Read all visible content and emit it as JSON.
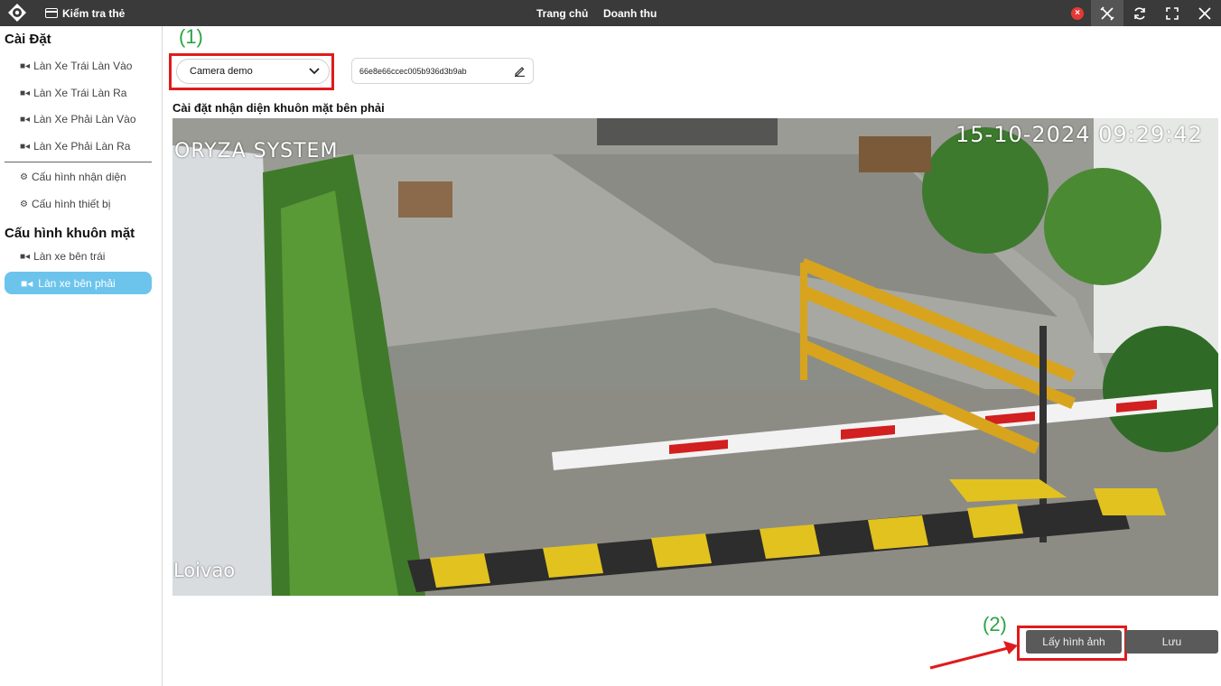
{
  "topbar": {
    "check_card_label": "Kiểm tra thẻ",
    "nav_home": "Trang chủ",
    "nav_revenue": "Doanh thu",
    "close_badge": "×"
  },
  "sidebar": {
    "section_settings": "Cài Đặt",
    "lane_items": [
      "Làn Xe Trái Làn Vào",
      "Làn Xe Trái Làn Ra",
      "Làn Xe Phải Làn Vào",
      "Làn Xe Phải Làn Ra"
    ],
    "config_items": [
      "Cấu hình nhận diện",
      "Cấu hình thiết bị"
    ],
    "section_face": "Cấu hình khuôn mặt",
    "face_items": [
      "Làn xe bên trái",
      "Làn xe bên phải"
    ]
  },
  "annotations": {
    "label_1": "(1)",
    "label_2": "(2)"
  },
  "main": {
    "camera_select_value": "Camera demo",
    "camera_id": "66e8e66ccec005b936d3b9ab",
    "title": "Cài đặt nhận diện khuôn mặt bên phải",
    "overlay_system": "ORYZA SYSTEM",
    "overlay_timestamp": "15-10-2024 09:29:42",
    "overlay_lane": "Loivao",
    "btn_capture": "Lấy hình ảnh",
    "btn_save": "Lưu"
  },
  "colors": {
    "topbar": "#3a3a3a",
    "active_item": "#6cc4ec",
    "annotation_green": "#2ca444",
    "annotation_red": "#e01b1b"
  }
}
